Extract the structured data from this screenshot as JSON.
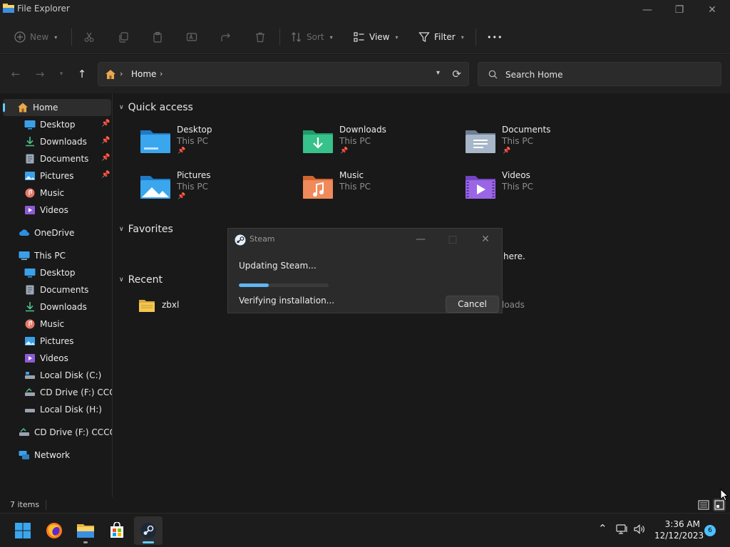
{
  "window": {
    "title": "File Explorer",
    "minimize_glyph": "—",
    "maximize_glyph": "❐",
    "close_glyph": "✕"
  },
  "toolbar": {
    "new_label": "New",
    "sort_label": "Sort",
    "view_label": "View",
    "filter_label": "Filter",
    "more_label": "•••"
  },
  "address": {
    "current": "Home",
    "separator": "›"
  },
  "search": {
    "placeholder": "Search Home"
  },
  "sidebar": {
    "items": [
      {
        "label": "Home",
        "icon": "home-icon"
      },
      {
        "label": "Desktop",
        "icon": "desktop-icon",
        "pinned": true
      },
      {
        "label": "Downloads",
        "icon": "downloads-icon",
        "pinned": true
      },
      {
        "label": "Documents",
        "icon": "documents-icon",
        "pinned": true
      },
      {
        "label": "Pictures",
        "icon": "pictures-icon",
        "pinned": true
      },
      {
        "label": "Music",
        "icon": "music-icon"
      },
      {
        "label": "Videos",
        "icon": "videos-icon"
      },
      {
        "label": "OneDrive",
        "icon": "cloud-icon"
      },
      {
        "label": "This PC",
        "icon": "computer-icon"
      },
      {
        "label": "Desktop",
        "icon": "desktop-icon"
      },
      {
        "label": "Documents",
        "icon": "documents-icon"
      },
      {
        "label": "Downloads",
        "icon": "downloads-icon"
      },
      {
        "label": "Music",
        "icon": "music-icon"
      },
      {
        "label": "Pictures",
        "icon": "pictures-icon"
      },
      {
        "label": "Videos",
        "icon": "videos-icon"
      },
      {
        "label": "Local Disk (C:)",
        "icon": "drive-icon"
      },
      {
        "label": "CD Drive (F:) CCCO",
        "icon": "cd-drive-icon"
      },
      {
        "label": "Local Disk (H:)",
        "icon": "drive-icon"
      },
      {
        "label": "CD Drive (F:) CCCOM",
        "icon": "cd-drive-icon"
      },
      {
        "label": "Network",
        "icon": "network-icon"
      }
    ]
  },
  "content": {
    "quick_access_title": "Quick access",
    "favorites_title": "Favorites",
    "recent_title": "Recent",
    "quick_access": [
      {
        "name": "Desktop",
        "location": "This PC",
        "pinned": true
      },
      {
        "name": "Downloads",
        "location": "This PC",
        "pinned": true
      },
      {
        "name": "Documents",
        "location": "This PC",
        "pinned": true
      },
      {
        "name": "Pictures",
        "location": "This PC",
        "pinned": true
      },
      {
        "name": "Music",
        "location": "This PC",
        "pinned": false
      },
      {
        "name": "Videos",
        "location": "This PC",
        "pinned": false
      }
    ],
    "favorites_peek": "here.",
    "recent": [
      {
        "name": "zbxl",
        "location_peek": "loads"
      }
    ]
  },
  "dialog": {
    "title": "Steam",
    "status": "Updating Steam...",
    "substatus": "Verifying installation...",
    "cancel_label": "Cancel",
    "progress": 0.33
  },
  "statusbar": {
    "item_count": "7 items"
  },
  "taskbar": {
    "apps": [
      "start-icon",
      "firefox-icon",
      "file-explorer-icon",
      "store-icon",
      "steam-icon"
    ],
    "tray_chevron": "⌃",
    "time": "3:36 AM",
    "date": "12/12/2023",
    "notification_count": "6"
  },
  "colors": {
    "accent": "#60cdff",
    "background": "#191919",
    "chrome": "#202020"
  }
}
